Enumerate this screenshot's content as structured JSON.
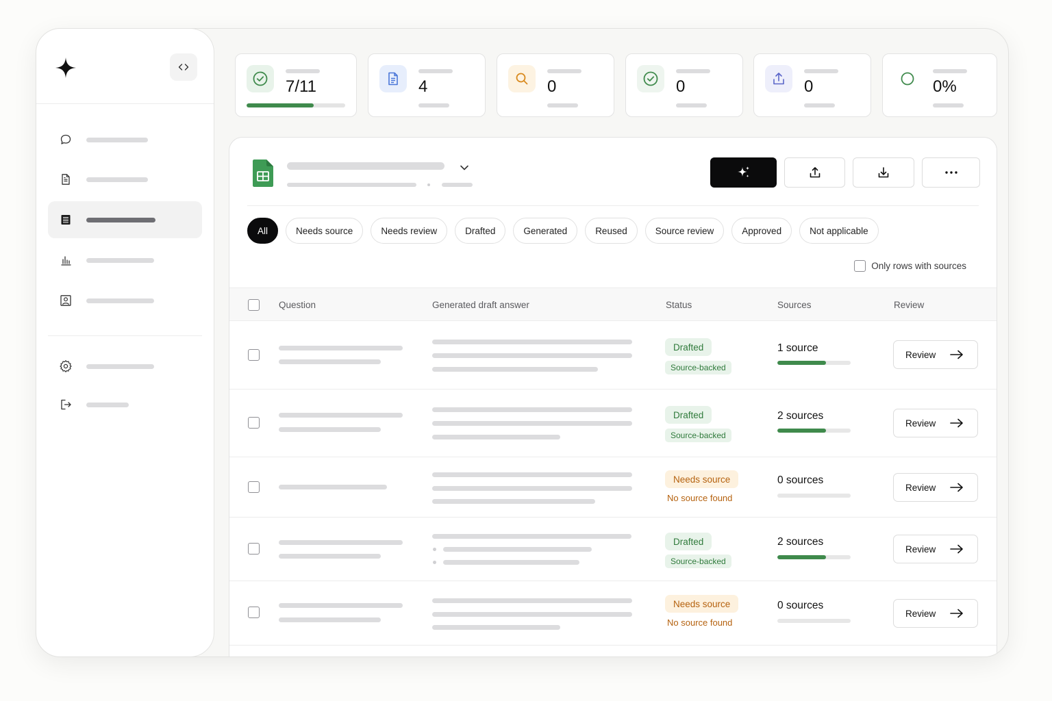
{
  "stats": [
    {
      "value": "7/11",
      "icon": "check-circle-icon",
      "progress": 0.68,
      "color": "#3f8a4c"
    },
    {
      "value": "4",
      "icon": "document-icon",
      "color": "#4a77d8"
    },
    {
      "value": "0",
      "icon": "search-icon",
      "color": "#d98a1e"
    },
    {
      "value": "0",
      "icon": "check-circle-icon",
      "color": "#3f8a4c"
    },
    {
      "value": "0",
      "icon": "upload-icon",
      "color": "#5b66c9"
    },
    {
      "value": "0%",
      "icon": "circle-icon",
      "color": "#3f8a4c"
    }
  ],
  "filters": [
    "All",
    "Needs source",
    "Needs review",
    "Drafted",
    "Generated",
    "Reused",
    "Source review",
    "Approved",
    "Not applicable"
  ],
  "active_filter": "All",
  "only_rows_label": "Only rows with sources",
  "columns": {
    "question": "Question",
    "answer": "Generated draft answer",
    "status": "Status",
    "sources": "Sources",
    "review": "Review"
  },
  "rows": [
    {
      "status": "Drafted",
      "status_type": "drafted",
      "note": "Source-backed",
      "sources": "1 source",
      "source_fill": 0.66,
      "review": "Review"
    },
    {
      "status": "Drafted",
      "status_type": "drafted",
      "note": "Source-backed",
      "sources": "2 sources",
      "source_fill": 0.66,
      "review": "Review"
    },
    {
      "status": "Needs source",
      "status_type": "needs",
      "note": "No source found",
      "sources": "0 sources",
      "source_fill": 0,
      "review": "Review"
    },
    {
      "status": "Drafted",
      "status_type": "drafted",
      "note": "Source-backed",
      "sources": "2 sources",
      "source_fill": 0.66,
      "review": "Review"
    },
    {
      "status": "Needs source",
      "status_type": "needs",
      "note": "No source found",
      "sources": "0 sources",
      "source_fill": 0,
      "review": "Review"
    }
  ],
  "colors": {
    "accent": "#0b0b0c",
    "success": "#3f8a4c",
    "warning": "#b5620f"
  }
}
